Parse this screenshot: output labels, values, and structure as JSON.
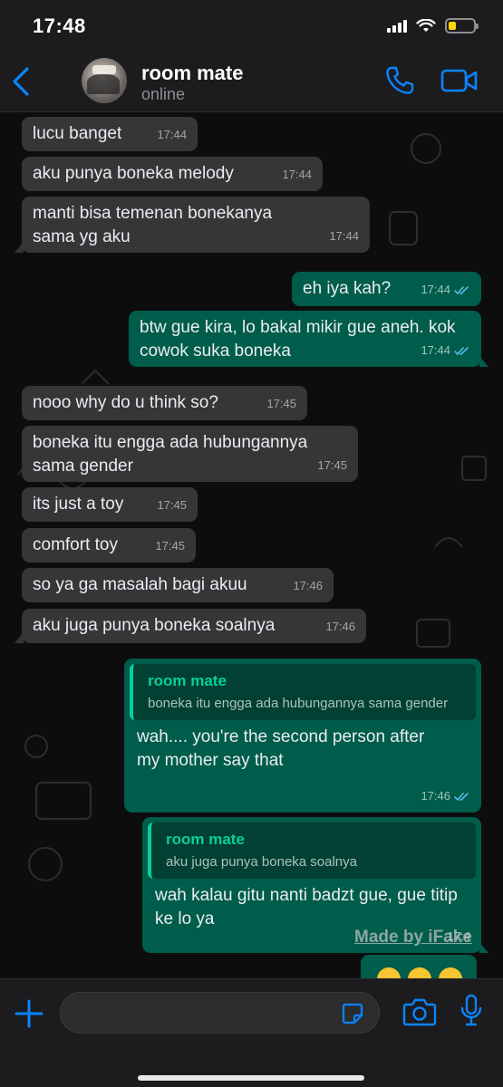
{
  "status_bar": {
    "time": "17:48"
  },
  "header": {
    "contact_name": "room mate",
    "contact_status": "online"
  },
  "messages": [
    {
      "text": "lucu banget",
      "time": "17:44"
    },
    {
      "text": "aku punya boneka melody",
      "time": "17:44"
    },
    {
      "text": "manti bisa temenan bonekanya sama yg aku",
      "time": "17:44"
    },
    {
      "text": "eh iya kah?",
      "time": "17:44"
    },
    {
      "text": "btw gue kira, lo bakal mikir gue aneh. kok cowok suka boneka",
      "time": "17:44"
    },
    {
      "text": "nooo why do u think so?",
      "time": "17:45"
    },
    {
      "text": "boneka itu engga ada hubungannya sama gender",
      "time": "17:45"
    },
    {
      "text": "its just a toy",
      "time": "17:45"
    },
    {
      "text": "comfort toy",
      "time": "17:45"
    },
    {
      "text": "so ya ga masalah bagi akuu",
      "time": "17:46"
    },
    {
      "text": "aku juga punya boneka soalnya",
      "time": "17:46"
    },
    {
      "text": "wah.... you're the second person after my mother say that",
      "time": "17:46",
      "quote": {
        "name": "room mate",
        "text": "boneka itu engga ada hubungannya sama gender"
      }
    },
    {
      "text": "wah kalau gitu nanti badzt gue, gue titip ke lo ya",
      "time": "17:4",
      "quote": {
        "name": "room mate",
        "text": "aku juga punya boneka soalnya"
      }
    }
  ],
  "watermark": "Made by iFake",
  "colors": {
    "accent": "#0a84ff",
    "incoming": "#363638",
    "outgoing": "#005c4b",
    "quote_accent": "#06cf9c"
  },
  "icons": [
    "back-chevron-icon",
    "phone-icon",
    "video-camera-icon",
    "plus-icon",
    "sticker-icon",
    "camera-icon",
    "microphone-icon",
    "double-check-icon"
  ]
}
